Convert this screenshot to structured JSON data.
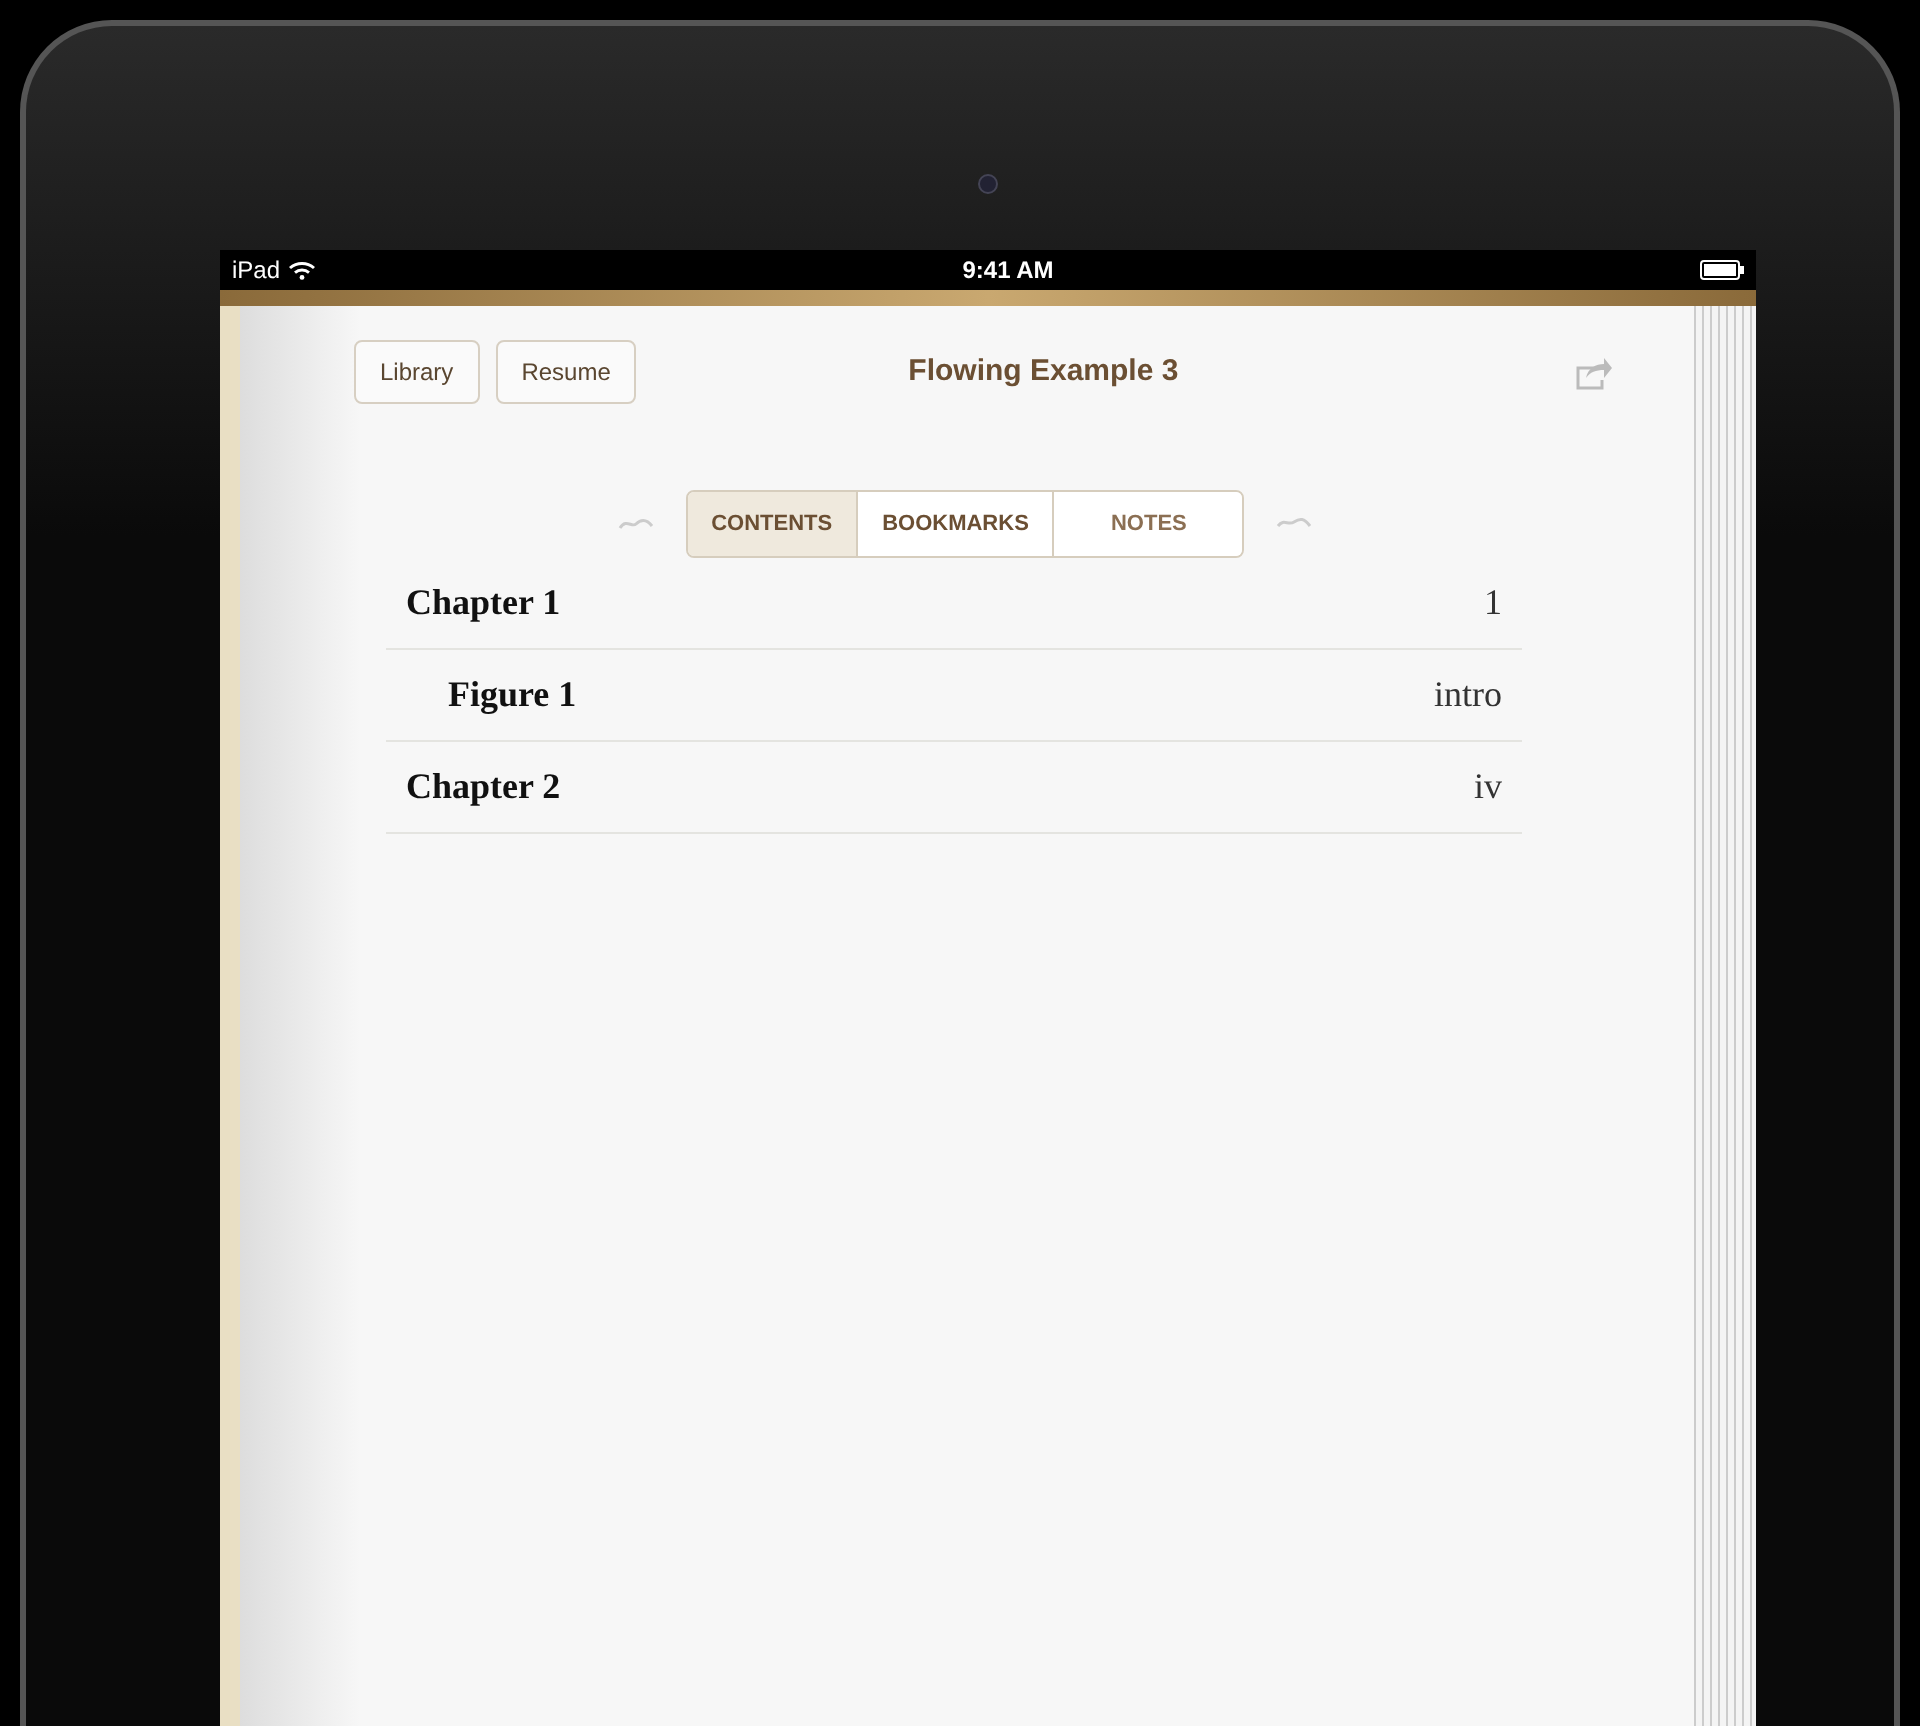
{
  "status_bar": {
    "device": "iPad",
    "time": "9:41 AM"
  },
  "toolbar": {
    "buttons": [
      "Library",
      "Resume"
    ],
    "title": "Flowing Example 3"
  },
  "tabs": [
    {
      "label": "CONTENTS",
      "selected": true
    },
    {
      "label": "BOOKMARKS",
      "selected": false
    },
    {
      "label": "NOTES",
      "selected": false
    }
  ],
  "contents": [
    {
      "title": "Chapter 1",
      "page": "1",
      "children": [
        {
          "title": "Figure 1",
          "page": "intro"
        }
      ]
    },
    {
      "title": "Chapter 2",
      "page": "iv"
    }
  ]
}
